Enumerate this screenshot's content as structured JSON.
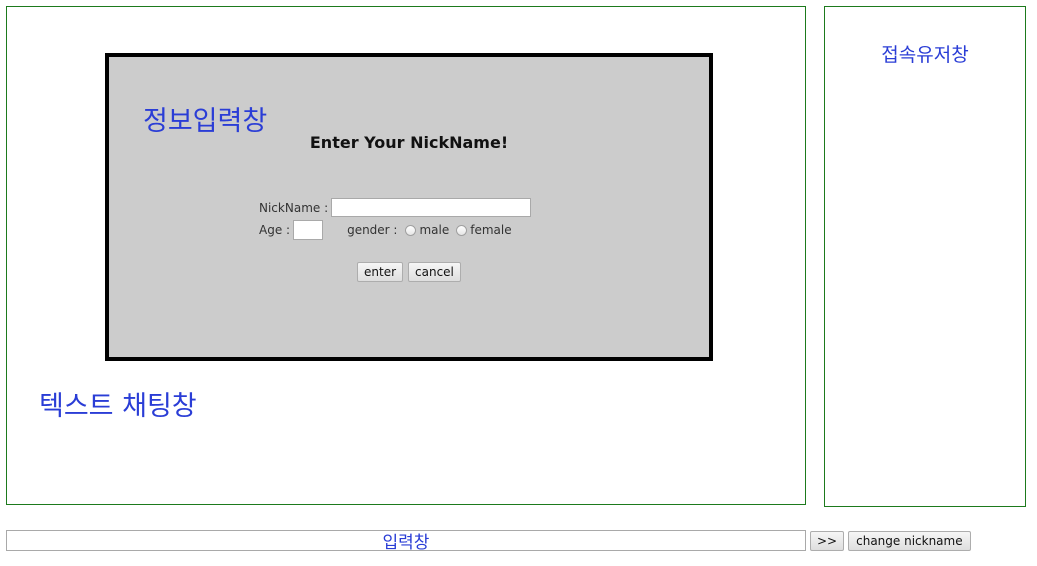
{
  "chat_area": {
    "label": "텍스트 채팅창"
  },
  "users_panel": {
    "title": "접속유저창"
  },
  "modal": {
    "label": "정보입력창",
    "heading": "Enter Your NickName!",
    "nickname_label": "NickName :",
    "nickname_value": "",
    "age_label": "Age :",
    "age_value": "",
    "gender_label": "gender :",
    "gender_options": [
      "male",
      "female"
    ],
    "enter_button": "enter",
    "cancel_button": "cancel"
  },
  "bottom_bar": {
    "message_value": "입력창",
    "send_button": ">>",
    "change_nickname_button": "change nickname"
  },
  "colors": {
    "border": "#1d7a1d",
    "label_blue": "#2a3dd6",
    "modal_bg": "#cccccc"
  }
}
